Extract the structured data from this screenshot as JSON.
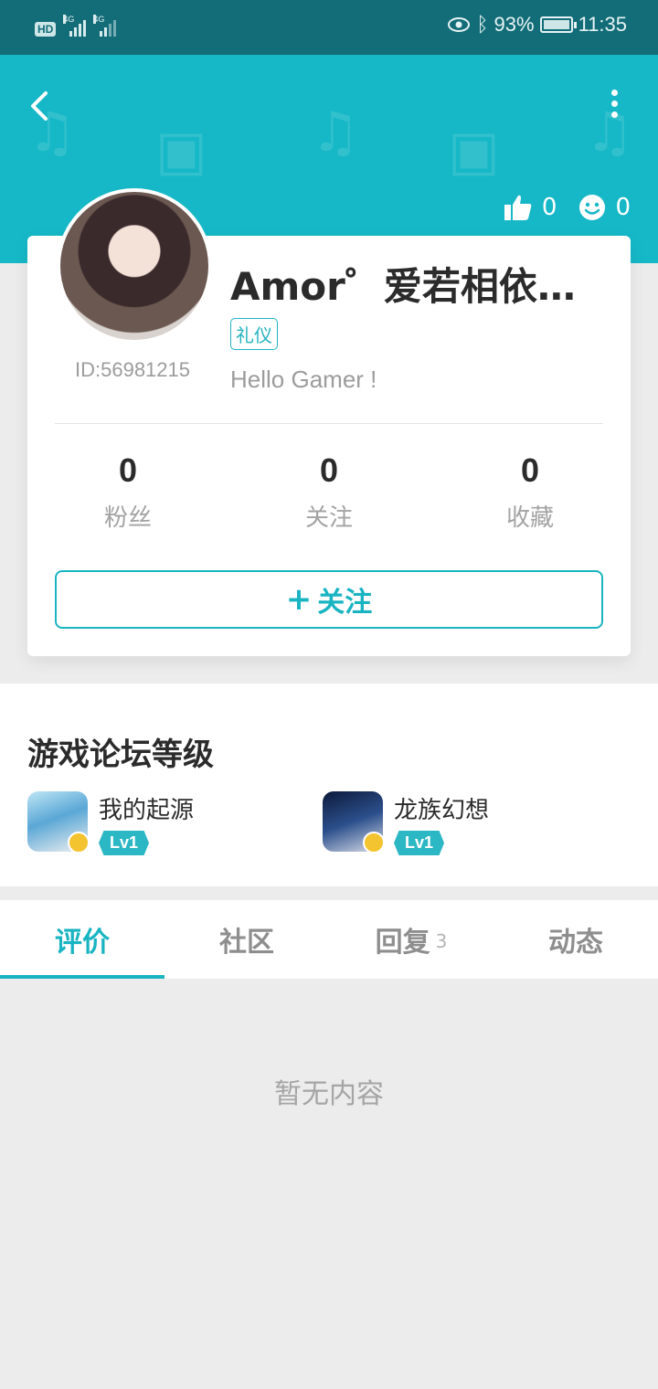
{
  "status_bar": {
    "hd": "HD",
    "sim1": "4G",
    "sim2": "4G",
    "battery": "93%",
    "time": "11:35"
  },
  "header": {
    "likes": "0",
    "smiles": "0",
    "accent": "#16b8c7"
  },
  "profile": {
    "name": "Amor゜爱若相依…",
    "id": "ID:56981215",
    "tag": "礼仪",
    "bio": "Hello Gamer !",
    "stats": [
      {
        "value": "0",
        "label": "粉丝"
      },
      {
        "value": "0",
        "label": "关注"
      },
      {
        "value": "0",
        "label": "收藏"
      }
    ],
    "follow_label": "关注",
    "follow_plus": "+"
  },
  "forum": {
    "title": "游戏论坛等级",
    "games": [
      {
        "name": "我的起源",
        "level": "Lv1"
      },
      {
        "name": "龙族幻想",
        "level": "Lv1"
      }
    ]
  },
  "tabs": [
    {
      "label": "评价",
      "count": ""
    },
    {
      "label": "社区",
      "count": ""
    },
    {
      "label": "回复",
      "count": "3"
    },
    {
      "label": "动态",
      "count": ""
    }
  ],
  "empty_text": "暂无内容"
}
